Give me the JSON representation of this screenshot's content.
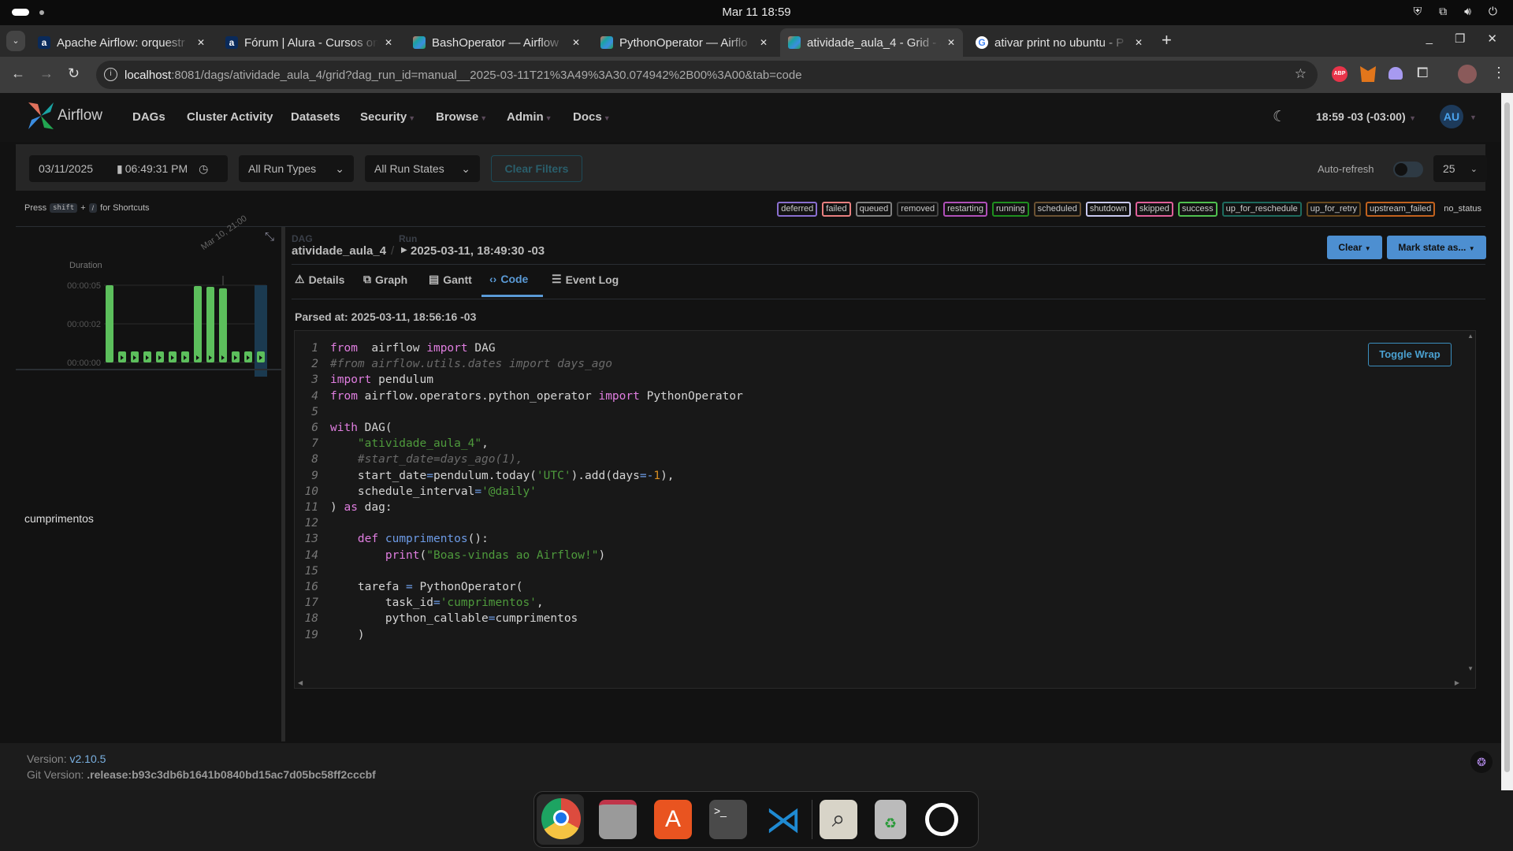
{
  "system": {
    "clock": "Mar 11  18:59"
  },
  "browser": {
    "tabs": [
      {
        "title": "Apache Airflow: orquestr",
        "icon": "alura-icon"
      },
      {
        "title": "Fórum | Alura - Cursos on",
        "icon": "alura-icon"
      },
      {
        "title": "BashOperator — Airflow",
        "icon": "airflow-icon"
      },
      {
        "title": "PythonOperator — Airflo",
        "icon": "airflow-icon"
      },
      {
        "title": "atividade_aula_4 - Grid - /",
        "icon": "airflow-icon",
        "active": true
      },
      {
        "title": "ativar print no ubuntu - P",
        "icon": "google-icon"
      }
    ],
    "url_host": "localhost",
    "url_rest": ":8081/dags/atividade_aula_4/grid?dag_run_id=manual__2025-03-11T21%3A49%3A30.074942%2B00%3A00&tab=code",
    "ext_abp": "ABP"
  },
  "nav": {
    "brand": "Airflow",
    "items": [
      "DAGs",
      "Cluster Activity",
      "Datasets",
      "Security",
      "Browse",
      "Admin",
      "Docs"
    ],
    "time": "18:59 -03 (-03:00)",
    "avatar": "AU"
  },
  "filters": {
    "date": "03/11/2025",
    "time": "06:49:31 PM",
    "run_types": "All Run Types",
    "run_states": "All Run States",
    "clear": "Clear Filters",
    "auto_refresh": "Auto-refresh",
    "auto_refresh_on": false,
    "limit": "25"
  },
  "shortcuts": {
    "press": "Press",
    "key1": "shift",
    "plus": "+",
    "key2": "/",
    "suffix": "for Shortcuts"
  },
  "legend": [
    {
      "label": "deferred",
      "color": "#8a6fd0"
    },
    {
      "label": "failed",
      "color": "#e88080"
    },
    {
      "label": "queued",
      "color": "#808080"
    },
    {
      "label": "removed",
      "color": "#444444"
    },
    {
      "label": "restarting",
      "color": "#b050b8"
    },
    {
      "label": "running",
      "color": "#1f8f1f"
    },
    {
      "label": "scheduled",
      "color": "#6b5233"
    },
    {
      "label": "shutdown",
      "color": "#c8c8ee"
    },
    {
      "label": "skipped",
      "color": "#e0609a"
    },
    {
      "label": "success",
      "color": "#4fbf4f"
    },
    {
      "label": "up_for_reschedule",
      "color": "#1e6b5e"
    },
    {
      "label": "up_for_retry",
      "color": "#6b4a1e"
    },
    {
      "label": "upstream_failed",
      "color": "#c2621e"
    },
    {
      "label": "no_status",
      "color": ""
    }
  ],
  "grid": {
    "duration_label": "Duration",
    "y_ticks": [
      "00:00:05",
      "00:00:02",
      "00:00:00"
    ],
    "hover_label": "Mar 10, 21:00",
    "task": "cumprimentos",
    "success_color": "#5cbf5c",
    "selected_color": "#1b3a50"
  },
  "chart_data": {
    "type": "bar",
    "ylabel": "Duration",
    "ylim": [
      0,
      5
    ],
    "y_tick_labels": [
      "00:00:00",
      "00:00:02",
      "00:00:05"
    ],
    "runs": [
      {
        "duration_s": 5.0,
        "state": "success",
        "manual": false,
        "task": "success"
      },
      {
        "duration_s": 0,
        "state": "success",
        "manual": true,
        "task": null
      },
      {
        "duration_s": 0,
        "state": "success",
        "manual": true,
        "task": null
      },
      {
        "duration_s": 0,
        "state": "success",
        "manual": true,
        "task": null
      },
      {
        "duration_s": 0,
        "state": "success",
        "manual": true,
        "task": null
      },
      {
        "duration_s": 0,
        "state": "success",
        "manual": true,
        "task": null
      },
      {
        "duration_s": 0,
        "state": "success",
        "manual": true,
        "task": null
      },
      {
        "duration_s": 4.95,
        "state": "success",
        "manual": true,
        "task": "success"
      },
      {
        "duration_s": 4.9,
        "state": "success",
        "manual": true,
        "task": "success"
      },
      {
        "duration_s": 4.8,
        "state": "success",
        "manual": true,
        "task": "success"
      },
      {
        "duration_s": 0,
        "state": "success",
        "manual": true,
        "task": null
      },
      {
        "duration_s": 0,
        "state": "success",
        "manual": true,
        "task": null
      },
      {
        "duration_s": 0,
        "state": "success",
        "manual": true,
        "task": null,
        "selected": true
      }
    ]
  },
  "dag": {
    "dag_label": "DAG",
    "dag_id": "atividade_aula_4",
    "run_label": "Run",
    "run": "2025-03-11, 18:49:30 -03",
    "clear": "Clear",
    "mark": "Mark state as..."
  },
  "tabs": [
    {
      "label": "Details",
      "icon": "warning-icon"
    },
    {
      "label": "Graph",
      "icon": "graph-icon"
    },
    {
      "label": "Gantt",
      "icon": "gantt-icon"
    },
    {
      "label": "Code",
      "icon": "code-icon",
      "active": true
    },
    {
      "label": "Event Log",
      "icon": "event-log-icon"
    }
  ],
  "parsed": "Parsed at: 2025-03-11, 18:56:16 -03",
  "toggle_wrap": "Toggle Wrap",
  "code": [
    [
      [
        "kw",
        "from"
      ],
      [
        "",
        "  airflow "
      ],
      [
        "kw",
        "import"
      ],
      [
        "",
        " DAG"
      ]
    ],
    [
      [
        "cm",
        "#from airflow.utils.dates import days_ago"
      ]
    ],
    [
      [
        "kw",
        "import"
      ],
      [
        "",
        " pendulum"
      ]
    ],
    [
      [
        "kw",
        "from"
      ],
      [
        "",
        " airflow.operators.python_operator "
      ],
      [
        "kw",
        "import"
      ],
      [
        "",
        " PythonOperator"
      ]
    ],
    [],
    [
      [
        "kw",
        "with"
      ],
      [
        "",
        " DAG("
      ]
    ],
    [
      [
        "",
        "    "
      ],
      [
        "str",
        "\"atividade_aula_4\""
      ],
      [
        "",
        ","
      ]
    ],
    [
      [
        "",
        "    "
      ],
      [
        "cm",
        "#start_date=days_ago(1),"
      ]
    ],
    [
      [
        "",
        "    start_date"
      ],
      [
        "op",
        "="
      ],
      [
        "",
        "pendulum.today("
      ],
      [
        "str",
        "'UTC'"
      ],
      [
        "",
        ").add(days"
      ],
      [
        "op",
        "=-"
      ],
      [
        "num",
        "1"
      ],
      [
        "",
        "),"
      ]
    ],
    [
      [
        "",
        "    schedule_interval"
      ],
      [
        "op",
        "="
      ],
      [
        "str",
        "'@daily'"
      ]
    ],
    [
      [
        "",
        ") "
      ],
      [
        "kw",
        "as"
      ],
      [
        "",
        " dag:"
      ]
    ],
    [],
    [
      [
        "",
        "    "
      ],
      [
        "kw",
        "def"
      ],
      [
        "",
        " "
      ],
      [
        "fn",
        "cumprimentos"
      ],
      [
        "",
        "():"
      ]
    ],
    [
      [
        "",
        "        "
      ],
      [
        "kw",
        "print"
      ],
      [
        "",
        "("
      ],
      [
        "str",
        "\"Boas-vindas ao Airflow!\""
      ],
      [
        "",
        ")"
      ]
    ],
    [],
    [
      [
        "",
        "    tarefa "
      ],
      [
        "op",
        "="
      ],
      [
        "",
        " PythonOperator("
      ]
    ],
    [
      [
        "",
        "        task_id"
      ],
      [
        "op",
        "="
      ],
      [
        "str",
        "'cumprimentos'"
      ],
      [
        "",
        ","
      ]
    ],
    [
      [
        "",
        "        python_callable"
      ],
      [
        "op",
        "="
      ],
      [
        "",
        "cumprimentos"
      ]
    ],
    [
      [
        "",
        "    )"
      ]
    ]
  ],
  "footer": {
    "version_label": "Version:",
    "version": "v2.10.5",
    "git_label": "Git Version:",
    "git": ".release:b93c3db6b1641b0840bd15ac7d05bc58ff2cccbf"
  },
  "dock": [
    "chrome",
    "files",
    "app-center",
    "terminal",
    "vscode",
    "image-viewer",
    "trash",
    "ubuntu"
  ]
}
